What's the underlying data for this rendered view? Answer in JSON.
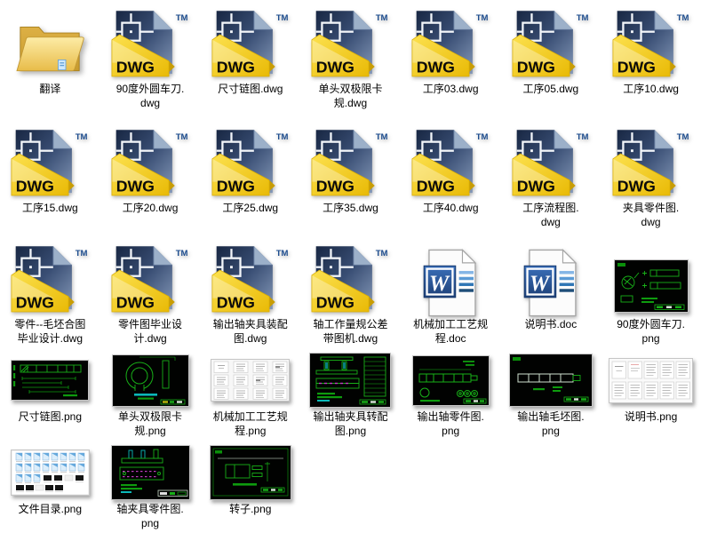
{
  "palette": {
    "background": "#ffffff",
    "dwg_yellow": "#f0c419",
    "dwg_navy": "#182743",
    "dwg_slate": "#8599b8",
    "tm_blue": "#1c4c8e",
    "word_blue": "#2a5caa",
    "folder_yellow": "#eec75e",
    "cad_green": "#18b018",
    "cad_cyan": "#0bb8b8",
    "cad_magenta": "#c13bc1",
    "cad_background": "#010201"
  },
  "badges": {
    "dwg": "DWG",
    "tm": "TM",
    "word": "W"
  },
  "rows": [
    {
      "items": [
        {
          "label": "翻译",
          "icon": "folder",
          "kind": "folder"
        },
        {
          "label": "90度外圆车刀.\ndwg",
          "icon": "dwg",
          "kind": "dwg-file"
        },
        {
          "label": "尺寸链图.dwg",
          "icon": "dwg",
          "kind": "dwg-file"
        },
        {
          "label": "单头双极限卡\n规.dwg",
          "icon": "dwg",
          "kind": "dwg-file"
        },
        {
          "label": "工序03.dwg",
          "icon": "dwg",
          "kind": "dwg-file"
        },
        {
          "label": "工序05.dwg",
          "icon": "dwg",
          "kind": "dwg-file"
        },
        {
          "label": "工序10.dwg",
          "icon": "dwg",
          "kind": "dwg-file"
        }
      ]
    },
    {
      "items": [
        {
          "label": "工序15.dwg",
          "icon": "dwg",
          "kind": "dwg-file"
        },
        {
          "label": "工序20.dwg",
          "icon": "dwg",
          "kind": "dwg-file"
        },
        {
          "label": "工序25.dwg",
          "icon": "dwg",
          "kind": "dwg-file"
        },
        {
          "label": "工序35.dwg",
          "icon": "dwg",
          "kind": "dwg-file"
        },
        {
          "label": "工序40.dwg",
          "icon": "dwg",
          "kind": "dwg-file"
        },
        {
          "label": "工序流程图.\ndwg",
          "icon": "dwg",
          "kind": "dwg-file"
        },
        {
          "label": "夹具零件图.\ndwg",
          "icon": "dwg",
          "kind": "dwg-file"
        }
      ]
    },
    {
      "items": [
        {
          "label": "零件--毛坯合图\n毕业设计.dwg",
          "icon": "dwg",
          "kind": "dwg-file"
        },
        {
          "label": "零件图毕业设\n计.dwg",
          "icon": "dwg",
          "kind": "dwg-file"
        },
        {
          "label": "输出轴夹具装配\n图.dwg",
          "icon": "dwg",
          "kind": "dwg-file"
        },
        {
          "label": "轴工作量规公差\n带图机.dwg",
          "icon": "dwg",
          "kind": "dwg-file"
        },
        {
          "label": "机械加工工艺规\n程.doc",
          "icon": "doc",
          "kind": "word-document"
        },
        {
          "label": "说明书.doc",
          "icon": "doc",
          "kind": "word-document"
        },
        {
          "label": "90度外圆车刀.\npng",
          "icon": "t_cutter",
          "kind": "png-image"
        }
      ]
    },
    {
      "items": [
        {
          "label": "尺寸链图.png",
          "icon": "t_chain",
          "kind": "png-image"
        },
        {
          "label": "单头双极限卡\n规.png",
          "icon": "t_ring",
          "kind": "png-image"
        },
        {
          "label": "机械加工工艺规\n程.png",
          "icon": "t_proc",
          "kind": "png-image"
        },
        {
          "label": "输出轴夹具转配\n图.png",
          "icon": "t_assembly",
          "kind": "png-image"
        },
        {
          "label": "输出轴零件图.\npng",
          "icon": "t_shaft",
          "kind": "png-image"
        },
        {
          "label": "输出轴毛坯图.\npng",
          "icon": "t_blank",
          "kind": "png-image"
        },
        {
          "label": "说明书.png",
          "icon": "t_manual",
          "kind": "png-image"
        }
      ]
    },
    {
      "items": [
        {
          "label": "文件目录.png",
          "icon": "t_catalog",
          "kind": "png-image"
        },
        {
          "label": "轴夹具零件图.\npng",
          "icon": "t_fixture",
          "kind": "png-image"
        },
        {
          "label": "转子.png",
          "icon": "t_rotor",
          "kind": "png-image"
        }
      ]
    }
  ]
}
